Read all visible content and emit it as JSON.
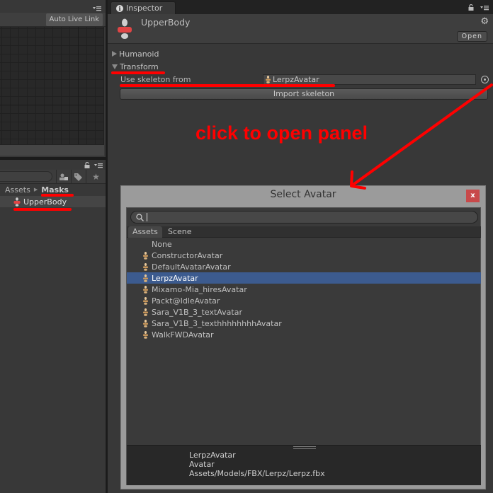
{
  "left_panel_top": {
    "auto_live_link_label": "Auto Live Link"
  },
  "left_panel_bottom": {
    "breadcrumb": [
      "Assets",
      "Masks"
    ],
    "items": [
      {
        "label": "UpperBody",
        "icon": "avatar-mask-icon"
      }
    ]
  },
  "inspector": {
    "tab_label": "Inspector",
    "asset_title": "UpperBody",
    "open_label": "Open",
    "foldouts": [
      {
        "label": "Humanoid",
        "expanded": false
      },
      {
        "label": "Transform",
        "expanded": true
      }
    ],
    "use_skeleton_label": "Use skeleton from",
    "use_skeleton_value": "LerpzAvatar",
    "import_skeleton_label": "Import skeleton"
  },
  "annotation": {
    "text": "click to open panel",
    "color": "#ff0000"
  },
  "select_avatar": {
    "title": "Select Avatar",
    "close_label": "x",
    "search_value": "",
    "tabs": [
      "Assets",
      "Scene"
    ],
    "active_tab": "Assets",
    "items": [
      {
        "label": "None",
        "icon": ""
      },
      {
        "label": "ConstructorAvatar",
        "icon": "avatar-icon"
      },
      {
        "label": "DefaultAvatarAvatar",
        "icon": "avatar-icon"
      },
      {
        "label": "LerpzAvatar",
        "icon": "avatar-icon",
        "selected": true
      },
      {
        "label": "Mixamo-Mia_hiresAvatar",
        "icon": "avatar-icon"
      },
      {
        "label": "Packt@IdleAvatar",
        "icon": "avatar-icon"
      },
      {
        "label": "Sara_V1B_3_textAvatar",
        "icon": "avatar-icon"
      },
      {
        "label": "Sara_V1B_3_texthhhhhhhhAvatar",
        "icon": "avatar-icon"
      },
      {
        "label": "WalkFWDAvatar",
        "icon": "avatar-icon"
      }
    ],
    "preview": {
      "name": "LerpzAvatar",
      "type": "Avatar",
      "path": "Assets/Models/FBX/Lerpz/Lerpz.fbx"
    },
    "selection_color": "#3c5b8f",
    "close_color": "#c8494a"
  }
}
